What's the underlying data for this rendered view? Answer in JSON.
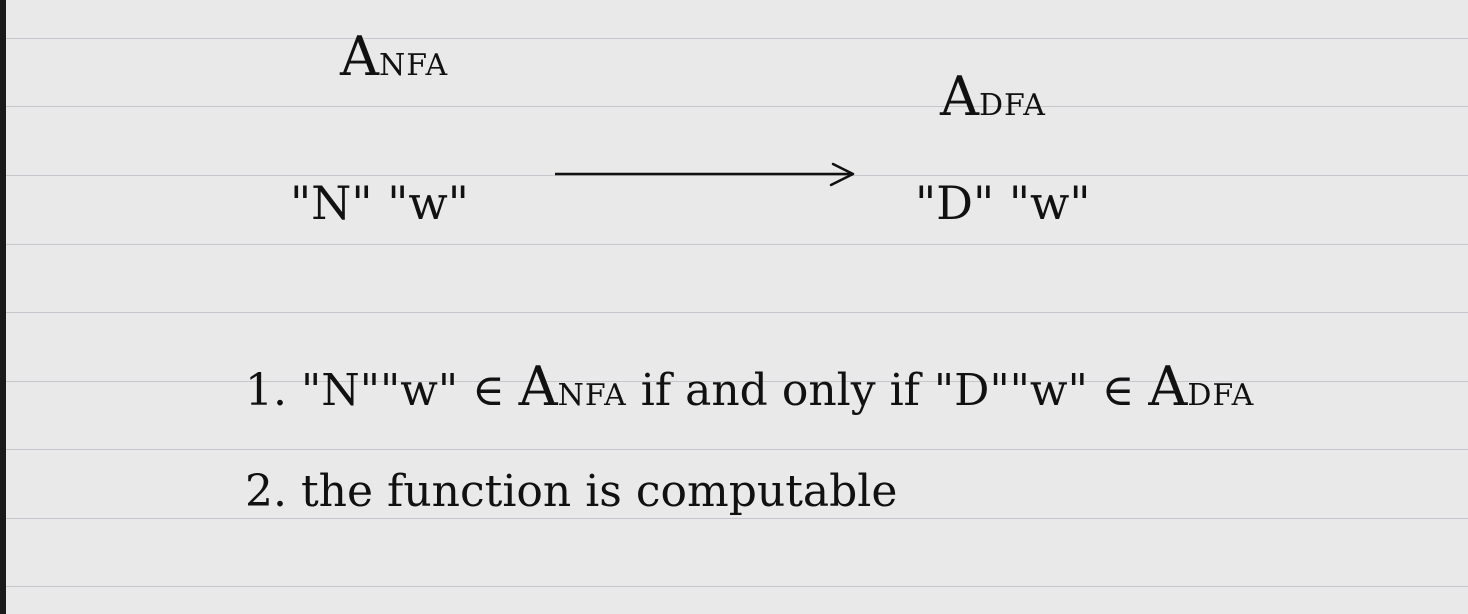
{
  "header": {
    "left_set": {
      "main": "A",
      "subscript": "NFA"
    },
    "right_set": {
      "main": "A",
      "subscript": "DFA"
    }
  },
  "mapping": {
    "left_input": "\"N\" \"w\"",
    "right_output": "\"D\" \"w\""
  },
  "statements": [
    {
      "number": "1.",
      "left": "\"N\"\"w\" ∈ ",
      "left_set": "A",
      "left_sub": "NFA",
      "middle": " if and only if ",
      "right": "\"D\"\"w\" ∈ ",
      "right_set": "A",
      "right_sub": "DFA"
    },
    {
      "number": "2.",
      "text": "the function is computable"
    }
  ]
}
